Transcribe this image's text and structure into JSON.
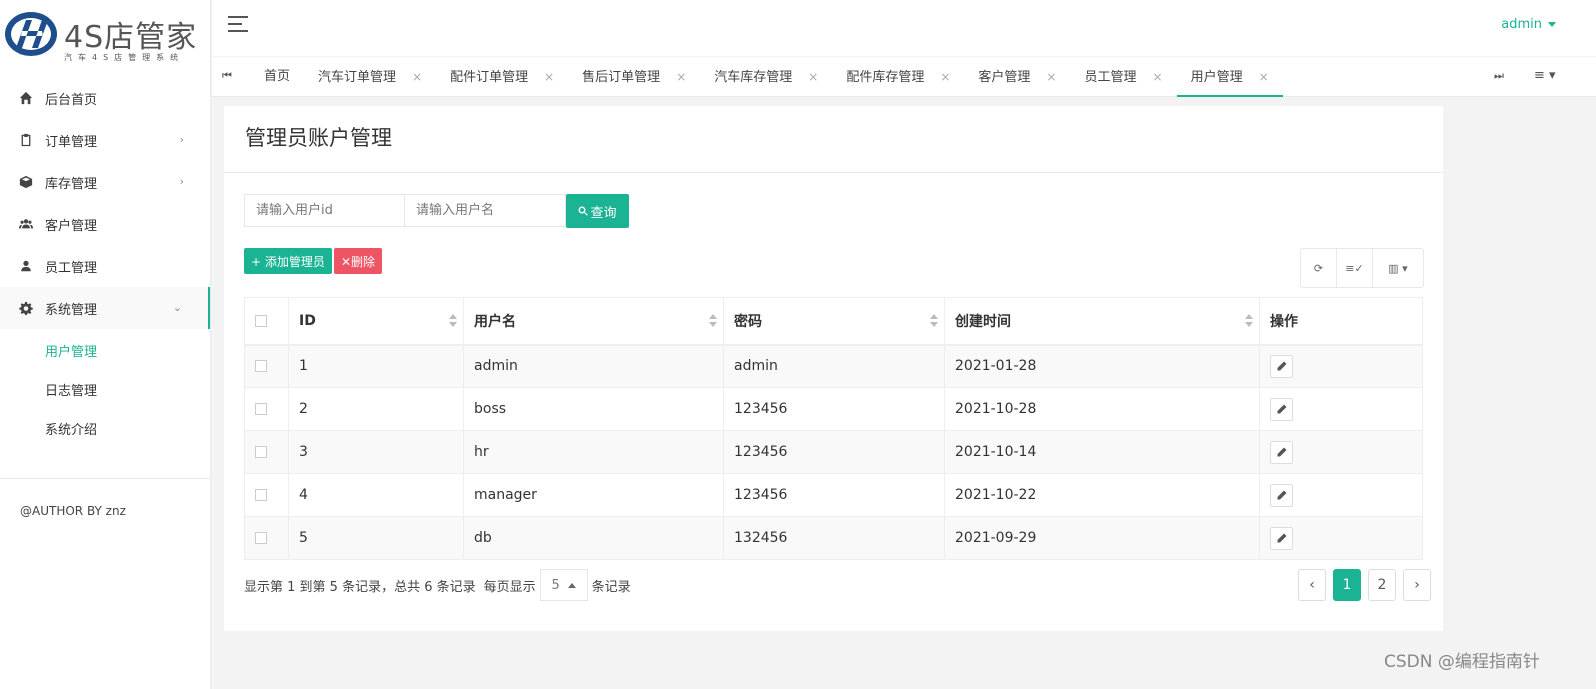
{
  "logo": {
    "title": "4S店管家",
    "subtitle": "汽车4S店管理系统"
  },
  "sidebar": {
    "items": [
      {
        "label": "后台首页",
        "icon": "home-icon"
      },
      {
        "label": "订单管理",
        "icon": "clipboard-icon"
      },
      {
        "label": "库存管理",
        "icon": "box-icon"
      },
      {
        "label": "客户管理",
        "icon": "users-icon"
      },
      {
        "label": "员工管理",
        "icon": "user-icon"
      },
      {
        "label": "系统管理",
        "icon": "gear-icon"
      }
    ],
    "submenu": [
      "用户管理",
      "日志管理",
      "系统介绍"
    ],
    "author": "@AUTHOR BY znz"
  },
  "header": {
    "user": "admin"
  },
  "tabs": [
    {
      "label": "首页",
      "closable": false
    },
    {
      "label": "汽车订单管理",
      "closable": true
    },
    {
      "label": "配件订单管理",
      "closable": true
    },
    {
      "label": "售后订单管理",
      "closable": true
    },
    {
      "label": "汽车库存管理",
      "closable": true
    },
    {
      "label": "配件库存管理",
      "closable": true
    },
    {
      "label": "客户管理",
      "closable": true
    },
    {
      "label": "员工管理",
      "closable": true
    },
    {
      "label": "用户管理",
      "closable": true
    }
  ],
  "main": {
    "title": "管理员账户管理",
    "search": {
      "id_placeholder": "请输入用户id",
      "name_placeholder": "请输入用户名",
      "button": "查询"
    },
    "add_button": "+ 添加管理员",
    "delete_button": "✕删除",
    "table": {
      "columns": [
        "ID",
        "用户名",
        "密码",
        "创建时间",
        "操作"
      ],
      "rows": [
        [
          "1",
          "admin",
          "admin",
          "2021-01-28"
        ],
        [
          "2",
          "boss",
          "123456",
          "2021-10-28"
        ],
        [
          "3",
          "hr",
          "123456",
          "2021-10-14"
        ],
        [
          "4",
          "manager",
          "123456",
          "2021-10-22"
        ],
        [
          "5",
          "db",
          "132456",
          "2021-09-29"
        ]
      ]
    },
    "pagination": {
      "info": "显示第 1 到第 5 条记录，总共 6 条记录",
      "per_page_prefix": "每页显示",
      "page_size": "5",
      "per_page_suffix": "条记录",
      "prev": "‹",
      "pages": [
        "1",
        "2"
      ],
      "next": "›"
    }
  },
  "watermark": "CSDN @编程指南针",
  "colors": {
    "accent": "#1ab394",
    "danger": "#ed5565"
  }
}
